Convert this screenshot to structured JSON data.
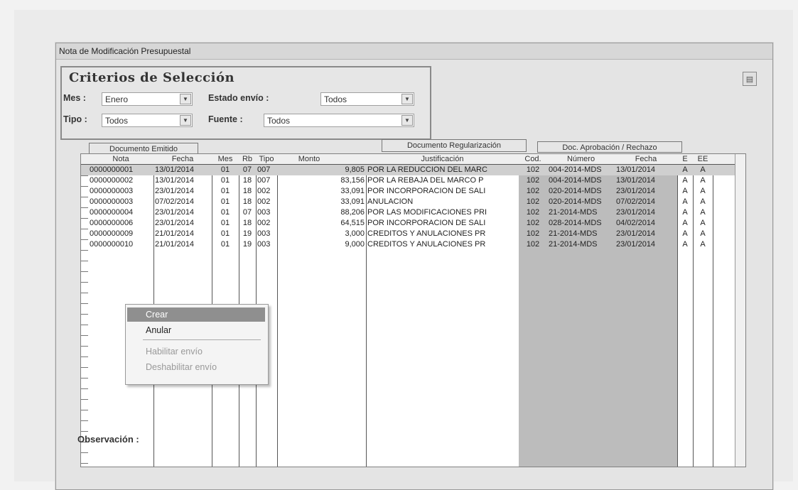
{
  "window": {
    "title": "Nota de Modificación Presupuestal"
  },
  "criteria": {
    "title": "Criterios de Selección",
    "mes_label": "Mes :",
    "mes_value": "Enero",
    "estado_label": "Estado envío :",
    "estado_value": "Todos",
    "tipo_label": "Tipo :",
    "tipo_value": "Todos",
    "fuente_label": "Fuente :",
    "fuente_value": "Todos"
  },
  "group_headers": {
    "documento_emitido": "Documento Emitido",
    "documento_regularizacion": "Documento Regularización",
    "doc_aprobacion": "Doc. Aprobación / Rechazo"
  },
  "columns": [
    "Nota",
    "Fecha",
    "Mes",
    "Rb",
    "Tipo",
    "Monto",
    "Justificación",
    "Cod.",
    "Número",
    "Fecha",
    "E",
    "EE"
  ],
  "rows": [
    {
      "nota": "0000000001",
      "fecha": "13/01/2014",
      "mes": "01",
      "rb": "07",
      "tipo": "007",
      "monto": "9,805",
      "just": "POR LA REDUCCION DEL MARC",
      "cod": "102",
      "numero": "004-2014-MDS",
      "fecha2": "13/01/2014",
      "e": "A",
      "ee": "A"
    },
    {
      "nota": "0000000002",
      "fecha": "13/01/2014",
      "mes": "01",
      "rb": "18",
      "tipo": "007",
      "monto": "83,156",
      "just": "POR LA REBAJA DEL MARCO P",
      "cod": "102",
      "numero": "004-2014-MDS",
      "fecha2": "13/01/2014",
      "e": "A",
      "ee": "A"
    },
    {
      "nota": "0000000003",
      "fecha": "23/01/2014",
      "mes": "01",
      "rb": "18",
      "tipo": "002",
      "monto": "33,091",
      "just": "POR INCORPORACION DE SALI",
      "cod": "102",
      "numero": "020-2014-MDS",
      "fecha2": "23/01/2014",
      "e": "A",
      "ee": "A"
    },
    {
      "nota": "0000000003",
      "fecha": "07/02/2014",
      "mes": "01",
      "rb": "18",
      "tipo": "002",
      "monto": "33,091",
      "just": "ANULACION",
      "cod": "102",
      "numero": "020-2014-MDS",
      "fecha2": "07/02/2014",
      "e": "A",
      "ee": "A"
    },
    {
      "nota": "0000000004",
      "fecha": "23/01/2014",
      "mes": "01",
      "rb": "07",
      "tipo": "003",
      "monto": "88,206",
      "just": "POR LAS MODIFICACIONES PRI",
      "cod": "102",
      "numero": "21-2014-MDS",
      "fecha2": "23/01/2014",
      "e": "A",
      "ee": "A"
    },
    {
      "nota": "0000000006",
      "fecha": "23/01/2014",
      "mes": "01",
      "rb": "18",
      "tipo": "002",
      "monto": "64,515",
      "just": "POR INCORPORACION DE SALI",
      "cod": "102",
      "numero": "028-2014-MDS",
      "fecha2": "04/02/2014",
      "e": "A",
      "ee": "A"
    },
    {
      "nota": "0000000009",
      "fecha": "21/01/2014",
      "mes": "01",
      "rb": "19",
      "tipo": "003",
      "monto": "3,000",
      "just": "CREDITOS Y ANULACIONES PR",
      "cod": "102",
      "numero": "21-2014-MDS",
      "fecha2": "23/01/2014",
      "e": "A",
      "ee": "A"
    },
    {
      "nota": "0000000010",
      "fecha": "21/01/2014",
      "mes": "01",
      "rb": "19",
      "tipo": "003",
      "monto": "9,000",
      "just": "CREDITOS Y ANULACIONES PR",
      "cod": "102",
      "numero": "21-2014-MDS",
      "fecha2": "23/01/2014",
      "e": "A",
      "ee": "A"
    }
  ],
  "context_menu": {
    "crear": "Crear",
    "anular": "Anular",
    "habilitar": "Habilitar envío",
    "deshabilitar": "Deshabilitar envío"
  },
  "observacion_label": "Observación :"
}
